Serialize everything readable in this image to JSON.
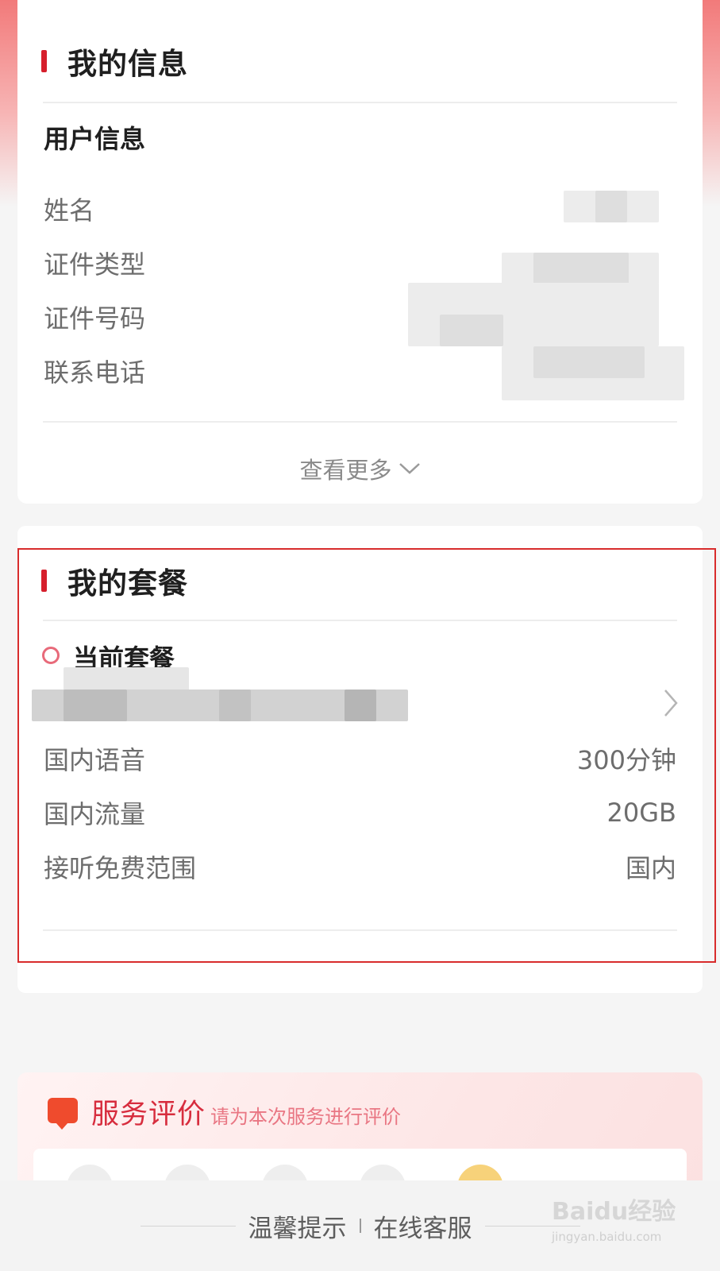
{
  "my_info": {
    "title": "我的信息",
    "user_info": {
      "heading": "用户信息",
      "fields": [
        {
          "label": "姓名",
          "value": ""
        },
        {
          "label": "证件类型",
          "value": ""
        },
        {
          "label": "证件号码",
          "value": ""
        },
        {
          "label": "联系电话",
          "value": ""
        }
      ]
    },
    "more_label": "查看更多"
  },
  "my_plan": {
    "title": "我的套餐",
    "current_heading": "当前套餐",
    "plan_name": "",
    "rows": [
      {
        "label": "国内语音",
        "value": "300分钟"
      },
      {
        "label": "国内流量",
        "value": "20GB"
      },
      {
        "label": "接听免费范围",
        "value": "国内"
      }
    ]
  },
  "evaluation": {
    "title": "服务评价",
    "subtitle": "请为本次服务进行评价"
  },
  "footer": {
    "tips": "温馨提示",
    "online_service": "在线客服"
  },
  "watermark": {
    "text": "Baidu经验",
    "url": "jingyan.baidu.com"
  },
  "colors": {
    "accent": "#d61f2c",
    "highlight_border": "#d82c2c",
    "eval_title": "#d72d3e"
  }
}
